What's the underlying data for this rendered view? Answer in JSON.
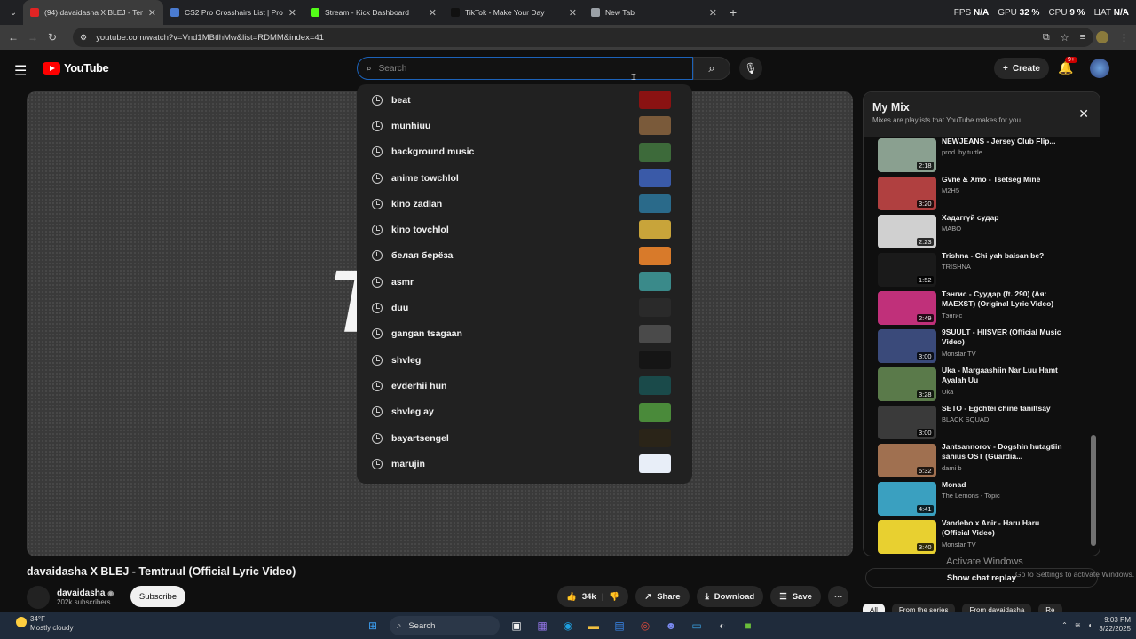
{
  "browser": {
    "tabs": [
      {
        "title": "(94) davaidasha X BLEJ - Temtr",
        "color": "#e02424",
        "active": true
      },
      {
        "title": "CS2 Pro Crosshairs List | ProCro",
        "color": "#4a7bd0",
        "active": false
      },
      {
        "title": "Stream - Kick Dashboard",
        "color": "#53fc18",
        "active": false
      },
      {
        "title": "TikTok - Make Your Day",
        "color": "#111111",
        "active": false
      },
      {
        "title": "New Tab",
        "color": "#9aa0a6",
        "active": false
      }
    ],
    "url": "youtube.com/watch?v=Vnd1MBtlhMw&list=RDMM&index=41",
    "stats": {
      "fps_label": "FPS",
      "fps_value": "N/A",
      "gpu_label": "GPU",
      "gpu_value": "32 %",
      "cpu_label": "CPU",
      "cpu_value": "9 %",
      "extra": "ЦАТ",
      "extra_value": "N/A"
    }
  },
  "youtube": {
    "logo_text": "YouTube",
    "search_placeholder": "Search",
    "create_label": "Create",
    "notif_badge": "9+",
    "suggestions": [
      {
        "text": "beat",
        "thumb": "#8a1212"
      },
      {
        "text": "munhiuu",
        "thumb": "#7a5a3a"
      },
      {
        "text": "background music",
        "thumb": "#3d6a3a"
      },
      {
        "text": "anime towchlol",
        "thumb": "#3a5aa8"
      },
      {
        "text": "kino zadlan",
        "thumb": "#2a6a8a"
      },
      {
        "text": "kino tovchlol",
        "thumb": "#c8a43a"
      },
      {
        "text": "белая берёза",
        "thumb": "#d87a2a"
      },
      {
        "text": "asmr",
        "thumb": "#3a8a8a"
      },
      {
        "text": "duu",
        "thumb": "#2a2a2a"
      },
      {
        "text": "gangan tsagaan",
        "thumb": "#4a4a4a"
      },
      {
        "text": "shvleg",
        "thumb": "#151515"
      },
      {
        "text": "evderhii hun",
        "thumb": "#1a4a4a"
      },
      {
        "text": "shvleg ay",
        "thumb": "#4a8a3a"
      },
      {
        "text": "bayartsengel",
        "thumb": "#2a2418"
      },
      {
        "text": "marujin",
        "thumb": "#e8eef8"
      }
    ],
    "video": {
      "overlay_text": "T",
      "title": "davaidasha X BLEJ - Temtruul (Official Lyric Video)",
      "channel": "davaidasha",
      "subscribers": "202k subscribers",
      "subscribe_label": "Subscribe",
      "likes": "34k",
      "share_label": "Share",
      "download_label": "Download",
      "save_label": "Save"
    },
    "mix": {
      "title": "My Mix",
      "subtitle": "Mixes are playlists that YouTube makes for you",
      "items": [
        {
          "title": "NEWJEANS - Jersey Club Flip...",
          "artist": "prod. by turtle",
          "duration": "2:18",
          "color": "#8aa090"
        },
        {
          "title": "Gvne & Xmo - Tsetseg Mine",
          "artist": "M2H5",
          "duration": "3:20",
          "color": "#b04040"
        },
        {
          "title": "Хадаггүй судар",
          "artist": "MABO",
          "duration": "2:23",
          "color": "#d0d0d0"
        },
        {
          "title": "Trishna - Chi yah baisan be?",
          "artist": "TRISHNA",
          "duration": "1:52",
          "color": "#1a1a1a"
        },
        {
          "title": "Тэнгис - Суудар (ft. 290) (Ая: MAEXST) (Original Lyric Video)",
          "artist": "Тэнгис",
          "duration": "2:49",
          "color": "#c0307a"
        },
        {
          "title": "9SUULT - HIISVER (Official Music Video)",
          "artist": "Monstar TV",
          "duration": "3:00",
          "color": "#3a4a7a"
        },
        {
          "title": "Uka - Margaashiin Nar Luu Hamt Ayalah Uu",
          "artist": "Uka",
          "duration": "3:28",
          "color": "#5a7a4a"
        },
        {
          "title": "SETO - Egchtei chine taniltsay",
          "artist": "BLACK SQUAD",
          "duration": "3:00",
          "color": "#3a3a3a"
        },
        {
          "title": "Jantsannorov - Dogshin hutagtiin sahius OST (Guardia...",
          "artist": "dami b",
          "duration": "5:32",
          "color": "#a07050"
        },
        {
          "title": "Monad",
          "artist": "The Lemons - Topic",
          "duration": "4:41",
          "color": "#3aa0c0"
        },
        {
          "title": "Vandebo x Anir - Haru Haru (Official Video)",
          "artist": "Monstar TV",
          "duration": "3:40",
          "color": "#e8d030"
        }
      ],
      "show_chat": "Show chat replay",
      "chips": [
        "All",
        "From the series",
        "From davaidasha",
        "Re"
      ]
    },
    "watermark": {
      "line1": "Activate Windows",
      "line2": "Go to Settings to activate Windows."
    }
  },
  "taskbar": {
    "weather_temp": "34°F",
    "weather_desc": "Mostly cloudy",
    "search_label": "Search",
    "time": "9:03 PM",
    "date": "3/22/2025"
  }
}
